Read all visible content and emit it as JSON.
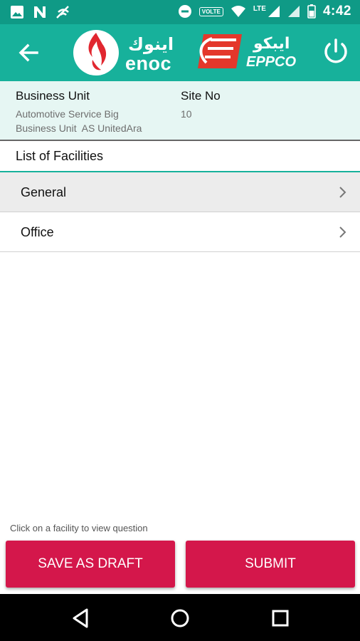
{
  "status_bar": {
    "time": "4:42",
    "volte": "VOLTE",
    "network": "LTE",
    "icons": [
      "image-icon",
      "n-icon",
      "signal-off-icon",
      "dnd-icon",
      "wifi-icon",
      "cell-signal-icon",
      "cell-signal-icon",
      "battery-icon"
    ]
  },
  "app_bar": {
    "back_icon": "arrow-left-icon",
    "enoc_arabic": "اينوك",
    "enoc_name": "enoc",
    "eppco_arabic": "ايبكو",
    "eppco_name": "EPPCO",
    "power_icon": "power-icon",
    "colors": {
      "bar": "#17b19b",
      "status": "#0f9a86",
      "enoc_red": "#e1262f",
      "eppco_red": "#e4372b"
    }
  },
  "info": {
    "business_unit_label": "Business Unit",
    "business_unit_line1": "Automotive Service Big",
    "business_unit_line2": "Business Unit  AS UnitedAra",
    "site_no_label": "Site No",
    "site_no_value": "10"
  },
  "list": {
    "title": "List of Facilities",
    "items": [
      {
        "label": "General",
        "selected": true
      },
      {
        "label": "Office",
        "selected": false
      }
    ]
  },
  "footer": {
    "hint": "Click on a facility to view question",
    "save_draft_label": "SAVE AS DRAFT",
    "submit_label": "SUBMIT",
    "button_color": "#d4174b"
  },
  "nav_bar": {
    "icons": [
      "back-triangle-icon",
      "home-circle-icon",
      "recents-square-icon"
    ]
  }
}
